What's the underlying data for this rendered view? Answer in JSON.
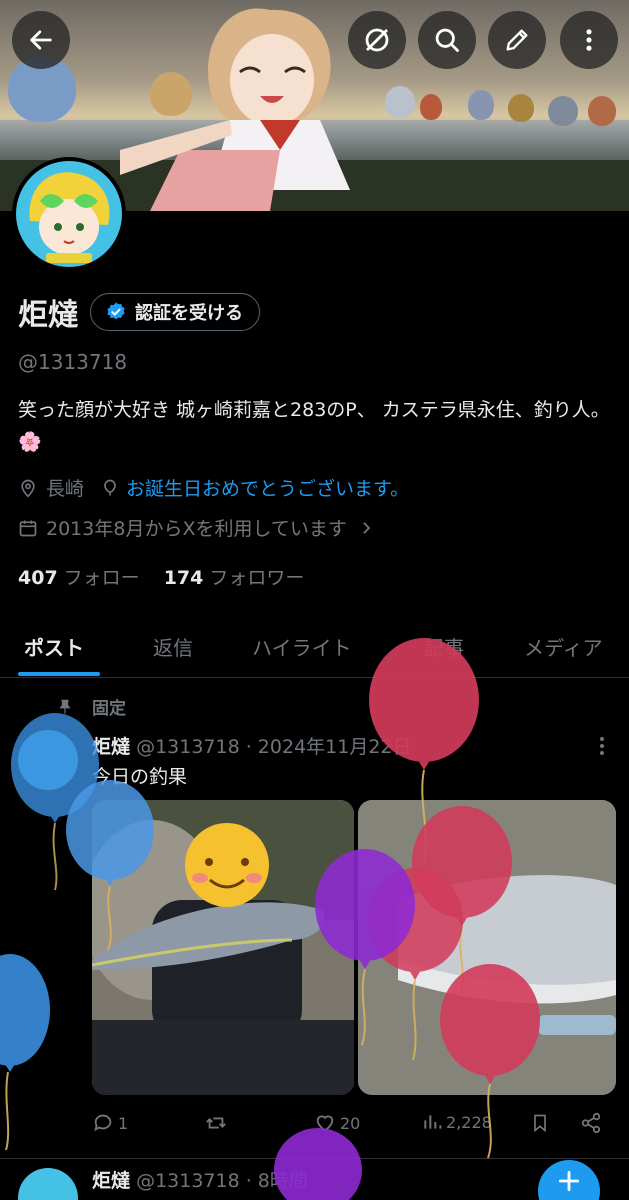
{
  "header": {
    "back_icon": "arrow-left-icon",
    "actions": [
      "circle-slash-icon",
      "search-icon",
      "edit-icon",
      "more-vertical-icon"
    ]
  },
  "profile": {
    "display_name": "炬燵",
    "verify_label": "認証を受ける",
    "handle": "@1313718",
    "bio": "笑った顔が大好き 城ヶ崎莉嘉と283のP、 カステラ県永住、釣り人。🌸",
    "location": "長崎",
    "birthday_text": "お誕生日おめでとうございます。",
    "joined": "2013年8月からXを利用しています",
    "following_count": "407",
    "following_label": "フォロー",
    "followers_count": "174",
    "followers_label": "フォロワー"
  },
  "tabs": [
    "ポスト",
    "返信",
    "ハイライト",
    "記事",
    "メディア"
  ],
  "pinned_tweet": {
    "pinned_label": "固定",
    "name": "炬燵",
    "handle_date": "@1313718 · 2024年11月22日",
    "text": "今日の釣果",
    "replies": "1",
    "retweets": "",
    "likes": "20",
    "views": "2,228"
  },
  "next_tweet": {
    "name": "炬燵",
    "handle_time": "@1313718 · 8時間"
  },
  "colors": {
    "accent": "#1d9bf0",
    "background": "#000000",
    "secondary_text": "#71767b"
  }
}
